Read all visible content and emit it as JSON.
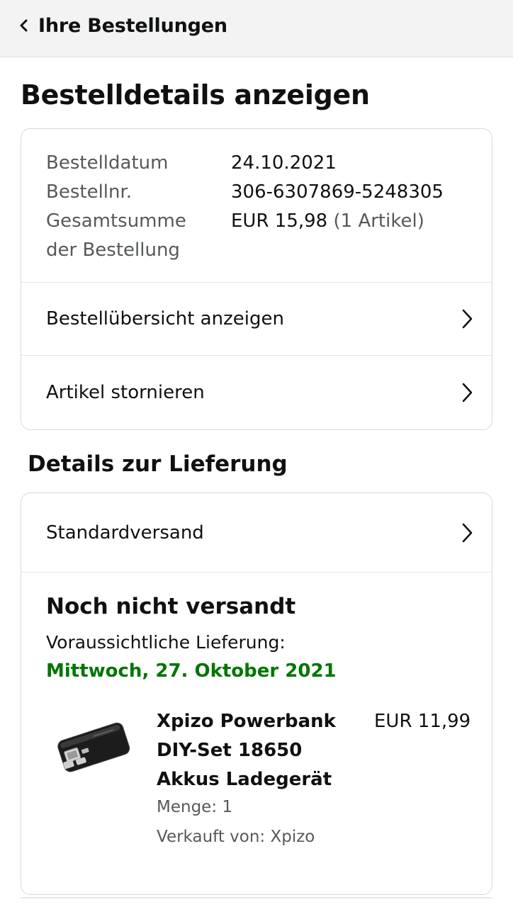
{
  "header": {
    "back_label": "Ihre Bestellungen",
    "back_icon": "chevron-left-icon"
  },
  "page_title": "Bestelldetails anzeigen",
  "order_info": {
    "date_label": "Bestelldatum",
    "date_value": "24.10.2021",
    "number_label": "Bestellnr.",
    "number_value": "306-6307869-5248305",
    "total_label_line1": "Gesamtsumme",
    "total_label_line2": "der Bestellung",
    "total_value": "EUR 15,98",
    "total_items": "(1 Artikel)"
  },
  "order_actions": [
    {
      "label": "Bestellübersicht anzeigen",
      "icon": "chevron-right-icon"
    },
    {
      "label": "Artikel stornieren",
      "icon": "chevron-right-icon"
    }
  ],
  "delivery": {
    "section_title": "Details zur Lieferung",
    "shipping_method": "Standardversand",
    "status": "Noch nicht versandt",
    "expected_label": "Voraussichtliche Lieferung:",
    "expected_date": "Mittwoch, 27. Oktober 2021",
    "date_color": "#007600"
  },
  "product": {
    "name_line1": "Xpizo Powerbank",
    "name_line2": "DIY-Set 18650",
    "name_line3": "Akkus Ladegerät",
    "price": "EUR 11,99",
    "quantity": "Menge: 1",
    "seller": "Verkauft von: Xpizo",
    "image": "powerbank-image"
  }
}
